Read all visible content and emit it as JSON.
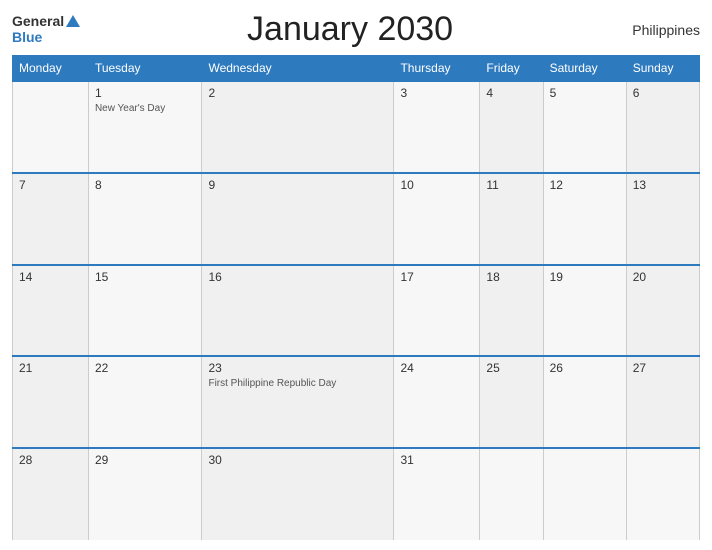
{
  "header": {
    "title": "January 2030",
    "country": "Philippines",
    "logo_general": "General",
    "logo_blue": "Blue"
  },
  "days_of_week": [
    "Monday",
    "Tuesday",
    "Wednesday",
    "Thursday",
    "Friday",
    "Saturday",
    "Sunday"
  ],
  "weeks": [
    [
      {
        "day": "",
        "holiday": ""
      },
      {
        "day": "1",
        "holiday": "New Year's Day"
      },
      {
        "day": "2",
        "holiday": ""
      },
      {
        "day": "3",
        "holiday": ""
      },
      {
        "day": "4",
        "holiday": ""
      },
      {
        "day": "5",
        "holiday": ""
      },
      {
        "day": "6",
        "holiday": ""
      }
    ],
    [
      {
        "day": "7",
        "holiday": ""
      },
      {
        "day": "8",
        "holiday": ""
      },
      {
        "day": "9",
        "holiday": ""
      },
      {
        "day": "10",
        "holiday": ""
      },
      {
        "day": "11",
        "holiday": ""
      },
      {
        "day": "12",
        "holiday": ""
      },
      {
        "day": "13",
        "holiday": ""
      }
    ],
    [
      {
        "day": "14",
        "holiday": ""
      },
      {
        "day": "15",
        "holiday": ""
      },
      {
        "day": "16",
        "holiday": ""
      },
      {
        "day": "17",
        "holiday": ""
      },
      {
        "day": "18",
        "holiday": ""
      },
      {
        "day": "19",
        "holiday": ""
      },
      {
        "day": "20",
        "holiday": ""
      }
    ],
    [
      {
        "day": "21",
        "holiday": ""
      },
      {
        "day": "22",
        "holiday": ""
      },
      {
        "day": "23",
        "holiday": "First Philippine Republic Day"
      },
      {
        "day": "24",
        "holiday": ""
      },
      {
        "day": "25",
        "holiday": ""
      },
      {
        "day": "26",
        "holiday": ""
      },
      {
        "day": "27",
        "holiday": ""
      }
    ],
    [
      {
        "day": "28",
        "holiday": ""
      },
      {
        "day": "29",
        "holiday": ""
      },
      {
        "day": "30",
        "holiday": ""
      },
      {
        "day": "31",
        "holiday": ""
      },
      {
        "day": "",
        "holiday": ""
      },
      {
        "day": "",
        "holiday": ""
      },
      {
        "day": "",
        "holiday": ""
      }
    ]
  ]
}
